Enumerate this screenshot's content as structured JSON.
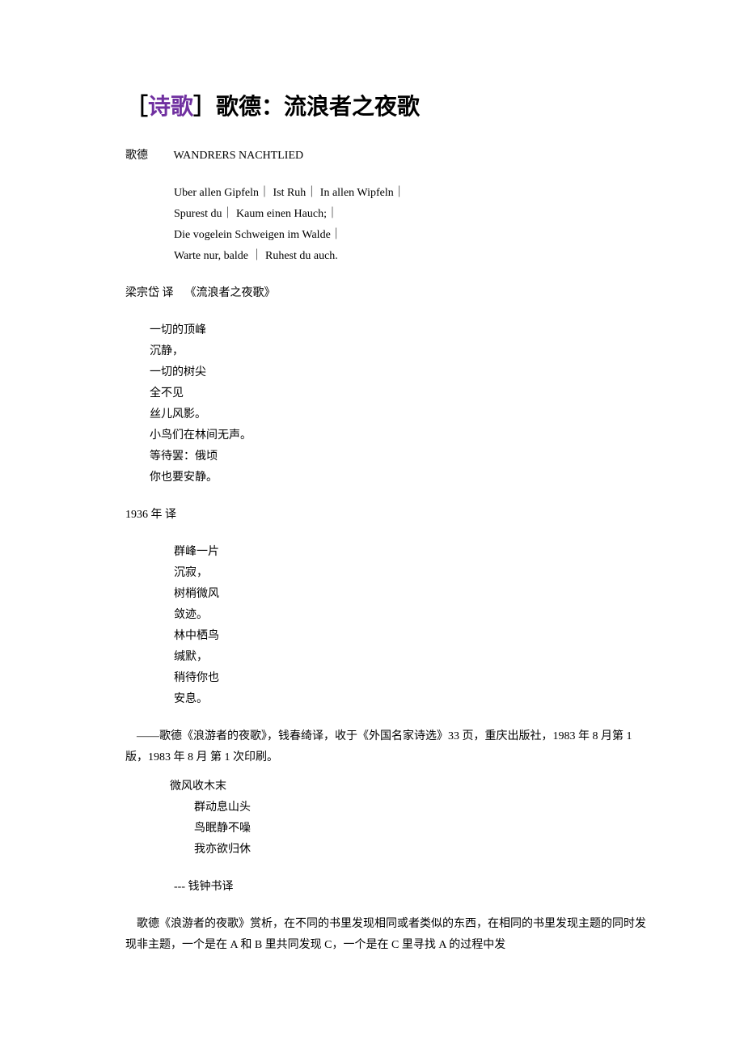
{
  "heading": {
    "bracket_open": "［",
    "category": "诗歌",
    "bracket_close": "］",
    "title": "歌德：流浪者之夜歌"
  },
  "author_line": "歌德         WANDRERS NACHTLIED",
  "original": [
    "Uber allen Gipfeln｜ Ist Ruh｜ In allen Wipfeln｜",
    "Spurest du｜ Kaum einen Hauch;｜",
    "Die vogelein Schweigen im Walde｜",
    "Warte nur, balde ｜ Ruhest du auch."
  ],
  "translator1_header": "梁宗岱 译    《流浪者之夜歌》",
  "translation1": [
    "一切的顶峰",
    "沉静，",
    "一切的树尖",
    "全不见",
    "丝儿风影。",
    "小鸟们在林间无声。",
    "等待罢：俄顷",
    "你也要安静。"
  ],
  "year_line": "1936 年 译",
  "translation2": [
    "群峰一片",
    "沉寂，",
    "树梢微风",
    "敛迹。",
    "林中栖鸟",
    "缄默，",
    "稍待你也",
    "安息。"
  ],
  "citation": "    ——歌德《浪游者的夜歌》，钱春绮译，收于《外国名家诗选》33 页，重庆出版社，1983 年 8 月第 1 版，1983 年 8 月 第 1 次印刷。",
  "translation3": {
    "first": "微风收木末",
    "rest": [
      "群动息山头",
      "鸟眠静不噪",
      "我亦欲归休"
    ]
  },
  "attribution3": "--- 钱钟书译",
  "analysis": "    歌德《浪游者的夜歌》赏析，在不同的书里发现相同或者类似的东西，在相同的书里发现主题的同时发现非主题，一个是在 A 和 B 里共同发现 C，一个是在 C 里寻找 A 的过程中发"
}
